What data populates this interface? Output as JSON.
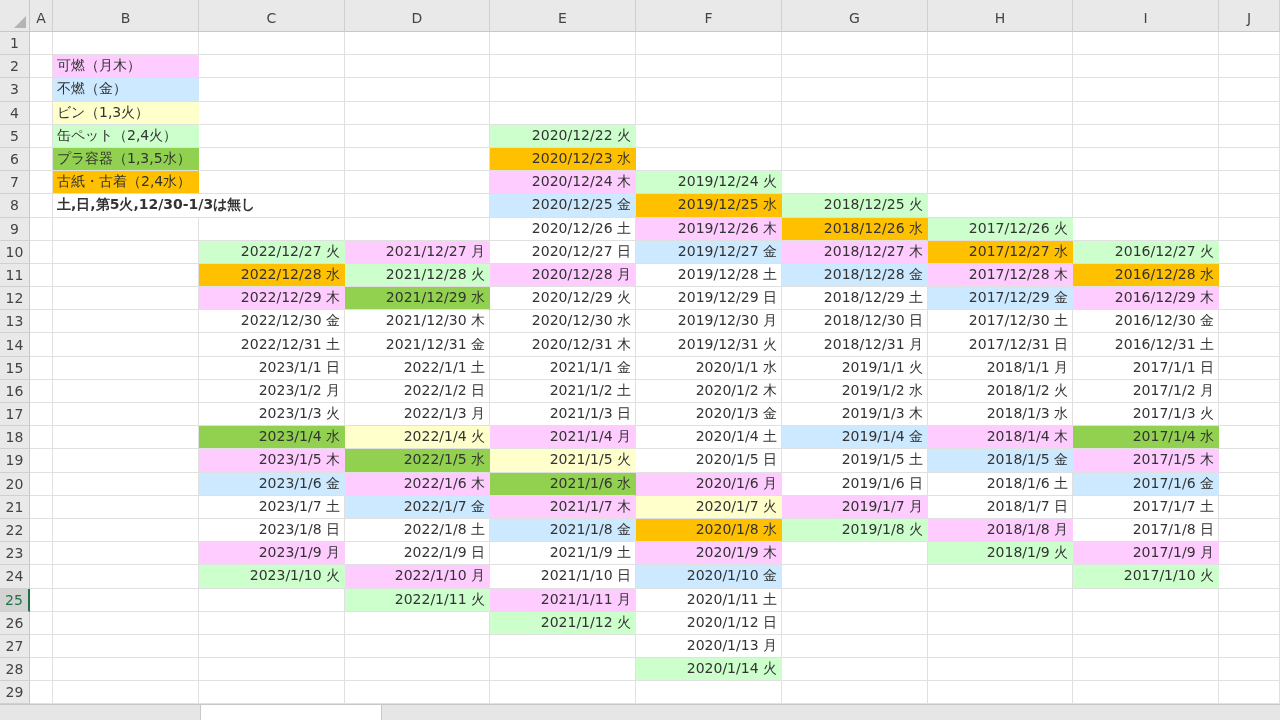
{
  "columns": [
    "A",
    "B",
    "C",
    "D",
    "E",
    "F",
    "G",
    "H",
    "I",
    "J"
  ],
  "rows": [
    {
      "number": "1",
      "selected": false,
      "cells": [
        {},
        {},
        {},
        {},
        {},
        {},
        {},
        {},
        {},
        {}
      ]
    },
    {
      "number": "2",
      "selected": false,
      "cells": [
        {},
        {
          "kind": "label",
          "text": "可燃（月木）",
          "color": "#ffccff"
        },
        {},
        {},
        {},
        {},
        {},
        {},
        {},
        {}
      ]
    },
    {
      "number": "3",
      "selected": false,
      "cells": [
        {},
        {
          "kind": "label",
          "text": "不燃（金）",
          "color": "#cce9ff"
        },
        {},
        {},
        {},
        {},
        {},
        {},
        {},
        {}
      ]
    },
    {
      "number": "4",
      "selected": false,
      "cells": [
        {},
        {
          "kind": "label",
          "text": "ビン（1,3火）",
          "color": "#ffffcc"
        },
        {},
        {},
        {},
        {},
        {},
        {},
        {},
        {}
      ]
    },
    {
      "number": "5",
      "selected": false,
      "cells": [
        {},
        {
          "kind": "label",
          "text": "缶ペット（2,4火）",
          "color": "#ccffcc"
        },
        {},
        {},
        {
          "kind": "date",
          "text": "2020/12/22 火",
          "color": "#ccffcc"
        },
        {},
        {},
        {},
        {},
        {}
      ]
    },
    {
      "number": "6",
      "selected": false,
      "cells": [
        {},
        {
          "kind": "label",
          "text": "プラ容器（1,3,5水）",
          "color": "#92d050"
        },
        {},
        {},
        {
          "kind": "date",
          "text": "2020/12/23 水",
          "color": "#ffc000"
        },
        {},
        {},
        {},
        {},
        {}
      ]
    },
    {
      "number": "7",
      "selected": false,
      "cells": [
        {},
        {
          "kind": "label",
          "text": "古紙・古着（2,4水）",
          "color": "#ffc000"
        },
        {},
        {},
        {
          "kind": "date",
          "text": "2020/12/24 木",
          "color": "#ffccff"
        },
        {
          "kind": "date",
          "text": "2019/12/24 火",
          "color": "#ccffcc"
        },
        {},
        {},
        {},
        {}
      ]
    },
    {
      "number": "8",
      "selected": false,
      "cells": [
        {},
        {
          "kind": "note",
          "text": "土,日,第5火,12/30-1/3は無し"
        },
        {},
        {
          "kind": "date",
          "text": "2020/12/25 金",
          "color": "#cce9ff"
        },
        {
          "kind": "date",
          "text": "2019/12/25 水",
          "color": "#ffc000"
        },
        {
          "kind": "date",
          "text": "2018/12/25 火",
          "color": "#ccffcc"
        },
        {},
        {},
        {}
      ]
    },
    {
      "number": "9",
      "selected": false,
      "cells": [
        {},
        {},
        {},
        {},
        {
          "kind": "date",
          "text": "2020/12/26 土"
        },
        {
          "kind": "date",
          "text": "2019/12/26 木",
          "color": "#ffccff"
        },
        {
          "kind": "date",
          "text": "2018/12/26 水",
          "color": "#ffc000"
        },
        {
          "kind": "date",
          "text": "2017/12/26 火",
          "color": "#ccffcc"
        },
        {},
        {}
      ]
    },
    {
      "number": "10",
      "selected": false,
      "cells": [
        {},
        {},
        {
          "kind": "date",
          "text": "2022/12/27 火",
          "color": "#ccffcc"
        },
        {
          "kind": "date",
          "text": "2021/12/27 月",
          "color": "#ffccff"
        },
        {
          "kind": "date",
          "text": "2020/12/27 日"
        },
        {
          "kind": "date",
          "text": "2019/12/27 金",
          "color": "#cce9ff"
        },
        {
          "kind": "date",
          "text": "2018/12/27 木",
          "color": "#ffccff"
        },
        {
          "kind": "date",
          "text": "2017/12/27 水",
          "color": "#ffc000"
        },
        {
          "kind": "date",
          "text": "2016/12/27 火",
          "color": "#ccffcc"
        },
        {}
      ]
    },
    {
      "number": "11",
      "selected": false,
      "cells": [
        {},
        {},
        {
          "kind": "date",
          "text": "2022/12/28 水",
          "color": "#ffc000"
        },
        {
          "kind": "date",
          "text": "2021/12/28 火",
          "color": "#ccffcc"
        },
        {
          "kind": "date",
          "text": "2020/12/28 月",
          "color": "#ffccff"
        },
        {
          "kind": "date",
          "text": "2019/12/28 土"
        },
        {
          "kind": "date",
          "text": "2018/12/28 金",
          "color": "#cce9ff"
        },
        {
          "kind": "date",
          "text": "2017/12/28 木",
          "color": "#ffccff"
        },
        {
          "kind": "date",
          "text": "2016/12/28 水",
          "color": "#ffc000"
        },
        {}
      ]
    },
    {
      "number": "12",
      "selected": false,
      "cells": [
        {},
        {},
        {
          "kind": "date",
          "text": "2022/12/29 木",
          "color": "#ffccff"
        },
        {
          "kind": "date",
          "text": "2021/12/29 水",
          "color": "#92d050"
        },
        {
          "kind": "date",
          "text": "2020/12/29 火"
        },
        {
          "kind": "date",
          "text": "2019/12/29 日"
        },
        {
          "kind": "date",
          "text": "2018/12/29 土"
        },
        {
          "kind": "date",
          "text": "2017/12/29 金",
          "color": "#cce9ff"
        },
        {
          "kind": "date",
          "text": "2016/12/29 木",
          "color": "#ffccff"
        },
        {}
      ]
    },
    {
      "number": "13",
      "selected": false,
      "cells": [
        {},
        {},
        {
          "kind": "date",
          "text": "2022/12/30 金"
        },
        {
          "kind": "date",
          "text": "2021/12/30 木"
        },
        {
          "kind": "date",
          "text": "2020/12/30 水"
        },
        {
          "kind": "date",
          "text": "2019/12/30 月"
        },
        {
          "kind": "date",
          "text": "2018/12/30 日"
        },
        {
          "kind": "date",
          "text": "2017/12/30 土"
        },
        {
          "kind": "date",
          "text": "2016/12/30 金"
        },
        {}
      ]
    },
    {
      "number": "14",
      "selected": false,
      "cells": [
        {},
        {},
        {
          "kind": "date",
          "text": "2022/12/31 土"
        },
        {
          "kind": "date",
          "text": "2021/12/31 金"
        },
        {
          "kind": "date",
          "text": "2020/12/31 木"
        },
        {
          "kind": "date",
          "text": "2019/12/31 火"
        },
        {
          "kind": "date",
          "text": "2018/12/31 月"
        },
        {
          "kind": "date",
          "text": "2017/12/31 日"
        },
        {
          "kind": "date",
          "text": "2016/12/31 土"
        },
        {}
      ]
    },
    {
      "number": "15",
      "selected": false,
      "cells": [
        {},
        {},
        {
          "kind": "date",
          "text": "2023/1/1 日"
        },
        {
          "kind": "date",
          "text": "2022/1/1 土"
        },
        {
          "kind": "date",
          "text": "2021/1/1 金"
        },
        {
          "kind": "date",
          "text": "2020/1/1 水"
        },
        {
          "kind": "date",
          "text": "2019/1/1 火"
        },
        {
          "kind": "date",
          "text": "2018/1/1 月"
        },
        {
          "kind": "date",
          "text": "2017/1/1 日"
        },
        {}
      ]
    },
    {
      "number": "16",
      "selected": false,
      "cells": [
        {},
        {},
        {
          "kind": "date",
          "text": "2023/1/2 月"
        },
        {
          "kind": "date",
          "text": "2022/1/2 日"
        },
        {
          "kind": "date",
          "text": "2021/1/2 土"
        },
        {
          "kind": "date",
          "text": "2020/1/2 木"
        },
        {
          "kind": "date",
          "text": "2019/1/2 水"
        },
        {
          "kind": "date",
          "text": "2018/1/2 火"
        },
        {
          "kind": "date",
          "text": "2017/1/2 月"
        },
        {}
      ]
    },
    {
      "number": "17",
      "selected": false,
      "cells": [
        {},
        {},
        {
          "kind": "date",
          "text": "2023/1/3 火"
        },
        {
          "kind": "date",
          "text": "2022/1/3 月"
        },
        {
          "kind": "date",
          "text": "2021/1/3 日"
        },
        {
          "kind": "date",
          "text": "2020/1/3 金"
        },
        {
          "kind": "date",
          "text": "2019/1/3 木"
        },
        {
          "kind": "date",
          "text": "2018/1/3 水"
        },
        {
          "kind": "date",
          "text": "2017/1/3 火"
        },
        {}
      ]
    },
    {
      "number": "18",
      "selected": false,
      "cells": [
        {},
        {},
        {
          "kind": "date",
          "text": "2023/1/4 水",
          "color": "#92d050"
        },
        {
          "kind": "date",
          "text": "2022/1/4 火",
          "color": "#ffffcc"
        },
        {
          "kind": "date",
          "text": "2021/1/4 月",
          "color": "#ffccff"
        },
        {
          "kind": "date",
          "text": "2020/1/4 土"
        },
        {
          "kind": "date",
          "text": "2019/1/4 金",
          "color": "#cce9ff"
        },
        {
          "kind": "date",
          "text": "2018/1/4 木",
          "color": "#ffccff"
        },
        {
          "kind": "date",
          "text": "2017/1/4 水",
          "color": "#92d050"
        },
        {}
      ]
    },
    {
      "number": "19",
      "selected": false,
      "cells": [
        {},
        {},
        {
          "kind": "date",
          "text": "2023/1/5 木",
          "color": "#ffccff"
        },
        {
          "kind": "date",
          "text": "2022/1/5 水",
          "color": "#92d050"
        },
        {
          "kind": "date",
          "text": "2021/1/5 火",
          "color": "#ffffcc"
        },
        {
          "kind": "date",
          "text": "2020/1/5 日"
        },
        {
          "kind": "date",
          "text": "2019/1/5 土"
        },
        {
          "kind": "date",
          "text": "2018/1/5 金",
          "color": "#cce9ff"
        },
        {
          "kind": "date",
          "text": "2017/1/5 木",
          "color": "#ffccff"
        },
        {}
      ]
    },
    {
      "number": "20",
      "selected": false,
      "cells": [
        {},
        {},
        {
          "kind": "date",
          "text": "2023/1/6 金",
          "color": "#cce9ff"
        },
        {
          "kind": "date",
          "text": "2022/1/6 木",
          "color": "#ffccff"
        },
        {
          "kind": "date",
          "text": "2021/1/6 水",
          "color": "#92d050"
        },
        {
          "kind": "date",
          "text": "2020/1/6 月",
          "color": "#ffccff"
        },
        {
          "kind": "date",
          "text": "2019/1/6 日"
        },
        {
          "kind": "date",
          "text": "2018/1/6 土"
        },
        {
          "kind": "date",
          "text": "2017/1/6 金",
          "color": "#cce9ff"
        },
        {}
      ]
    },
    {
      "number": "21",
      "selected": false,
      "cells": [
        {},
        {},
        {
          "kind": "date",
          "text": "2023/1/7 土"
        },
        {
          "kind": "date",
          "text": "2022/1/7 金",
          "color": "#cce9ff"
        },
        {
          "kind": "date",
          "text": "2021/1/7 木",
          "color": "#ffccff"
        },
        {
          "kind": "date",
          "text": "2020/1/7 火",
          "color": "#ffffcc"
        },
        {
          "kind": "date",
          "text": "2019/1/7 月",
          "color": "#ffccff"
        },
        {
          "kind": "date",
          "text": "2018/1/7 日"
        },
        {
          "kind": "date",
          "text": "2017/1/7 土"
        },
        {}
      ]
    },
    {
      "number": "22",
      "selected": false,
      "cells": [
        {},
        {},
        {
          "kind": "date",
          "text": "2023/1/8 日"
        },
        {
          "kind": "date",
          "text": "2022/1/8 土"
        },
        {
          "kind": "date",
          "text": "2021/1/8 金",
          "color": "#cce9ff"
        },
        {
          "kind": "date",
          "text": "2020/1/8 水",
          "color": "#ffc000"
        },
        {
          "kind": "date",
          "text": "2019/1/8 火",
          "color": "#ccffcc"
        },
        {
          "kind": "date",
          "text": "2018/1/8 月",
          "color": "#ffccff"
        },
        {
          "kind": "date",
          "text": "2017/1/8 日"
        },
        {}
      ]
    },
    {
      "number": "23",
      "selected": false,
      "cells": [
        {},
        {},
        {
          "kind": "date",
          "text": "2023/1/9 月",
          "color": "#ffccff"
        },
        {
          "kind": "date",
          "text": "2022/1/9 日"
        },
        {
          "kind": "date",
          "text": "2021/1/9 土"
        },
        {
          "kind": "date",
          "text": "2020/1/9 木",
          "color": "#ffccff"
        },
        {},
        {
          "kind": "date",
          "text": "2018/1/9 火",
          "color": "#ccffcc"
        },
        {
          "kind": "date",
          "text": "2017/1/9 月",
          "color": "#ffccff"
        },
        {}
      ]
    },
    {
      "number": "24",
      "selected": false,
      "cells": [
        {},
        {},
        {
          "kind": "date",
          "text": "2023/1/10 火",
          "color": "#ccffcc"
        },
        {
          "kind": "date",
          "text": "2022/1/10 月",
          "color": "#ffccff"
        },
        {
          "kind": "date",
          "text": "2021/1/10 日"
        },
        {
          "kind": "date",
          "text": "2020/1/10 金",
          "color": "#cce9ff"
        },
        {},
        {},
        {
          "kind": "date",
          "text": "2017/1/10 火",
          "color": "#ccffcc"
        },
        {}
      ]
    },
    {
      "number": "25",
      "selected": true,
      "cells": [
        {},
        {},
        {},
        {
          "kind": "date",
          "text": "2022/1/11 火",
          "color": "#ccffcc"
        },
        {
          "kind": "date",
          "text": "2021/1/11 月",
          "color": "#ffccff"
        },
        {
          "kind": "date",
          "text": "2020/1/11 土"
        },
        {},
        {},
        {},
        {}
      ]
    },
    {
      "number": "26",
      "selected": false,
      "cells": [
        {},
        {},
        {},
        {},
        {
          "kind": "date",
          "text": "2021/1/12 火",
          "color": "#ccffcc"
        },
        {
          "kind": "date",
          "text": "2020/1/12 日"
        },
        {},
        {},
        {},
        {}
      ]
    },
    {
      "number": "27",
      "selected": false,
      "cells": [
        {},
        {},
        {},
        {},
        {},
        {
          "kind": "date",
          "text": "2020/1/13 月"
        },
        {},
        {},
        {},
        {}
      ]
    },
    {
      "number": "28",
      "selected": false,
      "cells": [
        {},
        {},
        {},
        {},
        {},
        {
          "kind": "date",
          "text": "2020/1/14 火",
          "color": "#ccffcc"
        },
        {},
        {},
        {},
        {}
      ]
    },
    {
      "number": "29",
      "selected": false,
      "cells": [
        {},
        {},
        {},
        {},
        {},
        {},
        {},
        {},
        {},
        {}
      ]
    }
  ]
}
